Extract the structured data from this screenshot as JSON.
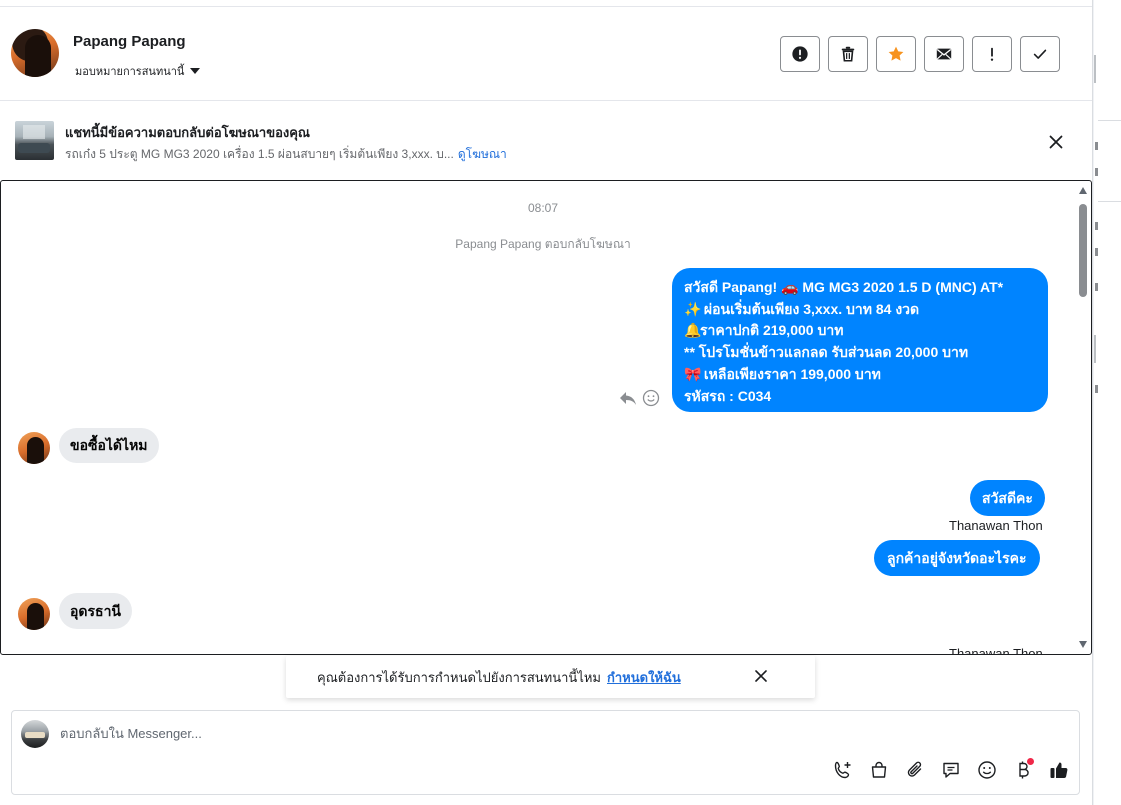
{
  "header": {
    "contact_name": "Papang Papang",
    "assign_label": "มอบหมายการสนทนานี้",
    "actions": [
      {
        "name": "spam-button",
        "icon": "alert-circle-icon"
      },
      {
        "name": "delete-button",
        "icon": "trash-icon"
      },
      {
        "name": "star-button",
        "icon": "star-icon"
      },
      {
        "name": "mark-unread-button",
        "icon": "envelope-icon"
      },
      {
        "name": "follow-up-button",
        "icon": "exclamation-icon"
      },
      {
        "name": "mark-done-button",
        "icon": "check-icon"
      }
    ]
  },
  "banner": {
    "title": "แชทนี้มีข้อความตอบกลับต่อโฆษณาของคุณ",
    "description": "รถเก๋ง 5 ประตู MG MG3 2020 เครื่อง 1.5 ผ่อนสบายๆ เริ่มต้นเพียง 3,xxx. บ...",
    "link": "ดูโฆษณา"
  },
  "chat": {
    "timestamp": "08:07",
    "replied_note": "Papang Papang ตอบกลับโฆษณา",
    "ad_message": {
      "lines": [
        {
          "prefix": "",
          "text": "สวัสดี Papang! 🚗  MG MG3 2020 1.5 D (MNC) AT*"
        },
        {
          "prefix": "✨",
          "text": " ผ่อนเริ่มต้นเพียง 3,xxx. บาท 84 งวด"
        },
        {
          "prefix": "🔔",
          "text": "ราคาปกติ 219,000 บาท"
        },
        {
          "prefix": "",
          "text": "** โปรโมชั่นข้าวแลกลด รับส่วนลด 20,000 บาท"
        },
        {
          "prefix": "🎀",
          "text": " เหลือเพียงราคา 199,000 บาท"
        },
        {
          "prefix": "",
          "text": " รหัสรถ : C034"
        }
      ]
    },
    "messages": [
      {
        "side": "in",
        "text": "ขอซื้อได้ไหม"
      },
      {
        "side": "out",
        "text": "สวัสดีคะ",
        "sender": "Thanawan Thon"
      },
      {
        "side": "out",
        "text": "ลูกค้าอยู่จังหวัดอะไรคะ"
      },
      {
        "side": "in",
        "text": "อุดรธานี"
      }
    ],
    "trailing_sender": "Thanawan Thon"
  },
  "assign_prompt": {
    "text": "คุณต้องการได้รับการกำหนดไปยังการสนทนานี้ไหม",
    "link": "กำหนดให้ฉัน"
  },
  "composer": {
    "placeholder": "ตอบกลับใน Messenger...",
    "icons": [
      "call-add-icon",
      "shopping-bag-icon",
      "paperclip-icon",
      "saved-reply-icon",
      "emoji-icon",
      "baht-payment-icon",
      "thumbs-up-icon"
    ]
  },
  "colors": {
    "accent": "#0084ff",
    "link": "#216fdb",
    "star": "#f7931e",
    "badge": "#f02849"
  }
}
